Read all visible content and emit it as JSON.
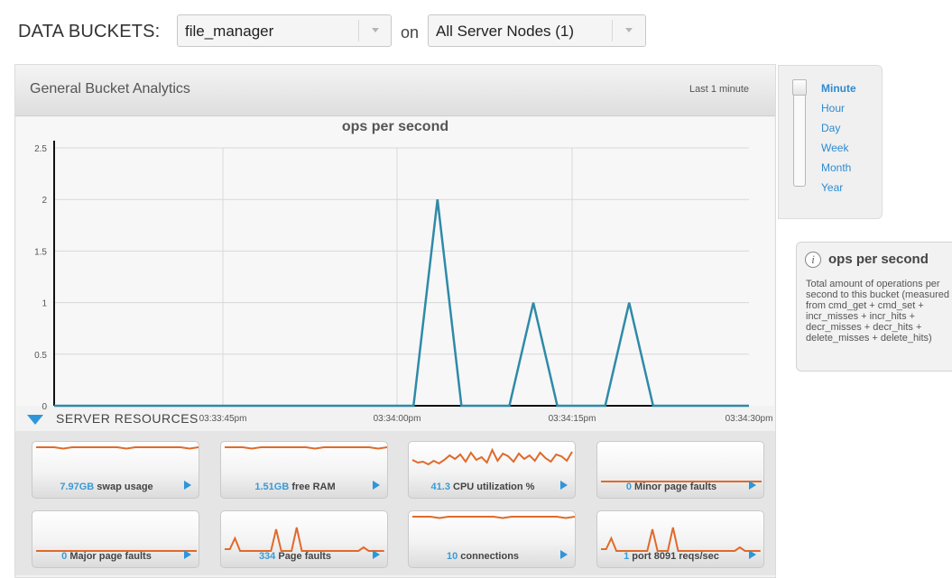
{
  "header": {
    "label": "DATA BUCKETS:",
    "bucket_select": "file_manager",
    "on_label": "on",
    "node_select": "All Server Nodes (1)"
  },
  "panel": {
    "title": "General Bucket Analytics",
    "range_label": "Last 1 minute"
  },
  "chart_data": {
    "type": "line",
    "title": "ops per second",
    "xlabel": "",
    "ylabel": "",
    "ylim": [
      0,
      2.5
    ],
    "y_ticks": [
      "0",
      "0.5",
      "1",
      "1.5",
      "2",
      "2.5"
    ],
    "x_ticks": [
      "03:33:45pm",
      "03:34:00pm",
      "03:34:15pm",
      "03:34:30pm"
    ],
    "x_range_seconds": [
      0,
      58
    ],
    "series": [
      {
        "x": [
          0,
          30,
          32,
          34,
          38,
          40,
          42,
          46,
          48,
          50,
          58
        ],
        "values": [
          0,
          0,
          2,
          0,
          0,
          1,
          0,
          0,
          1,
          0,
          0
        ],
        "color": "#2f8aa8"
      }
    ],
    "grid": true,
    "legend": "none"
  },
  "resources": {
    "section_label": "SERVER RESOURCES",
    "items": [
      {
        "value": "7.97GB",
        "label": "swap usage",
        "trend": "flat-high"
      },
      {
        "value": "1.51GB",
        "label": "free RAM",
        "trend": "flat-high"
      },
      {
        "value": "41.3",
        "label": "CPU utilization %",
        "trend": "noisy"
      },
      {
        "value": "0",
        "label": "Minor page faults",
        "trend": "flat-low"
      },
      {
        "value": "0",
        "label": "Major page faults",
        "trend": "flat-low"
      },
      {
        "value": "334",
        "label": "Page faults",
        "trend": "spikes"
      },
      {
        "value": "10",
        "label": "connections",
        "trend": "flat-high"
      },
      {
        "value": "1",
        "label": "port 8091 reqs/sec",
        "trend": "spikes"
      }
    ],
    "line_color": "#e06a2b",
    "value_color": "#3a9bd4"
  },
  "zoom": {
    "options": [
      "Minute",
      "Hour",
      "Day",
      "Week",
      "Month",
      "Year"
    ],
    "selected": "Minute"
  },
  "info": {
    "title": "ops per second",
    "text": "Total amount of operations per second to this bucket (measured from cmd_get + cmd_set + incr_misses + incr_hits + decr_misses + decr_hits + delete_misses + delete_hits)"
  }
}
